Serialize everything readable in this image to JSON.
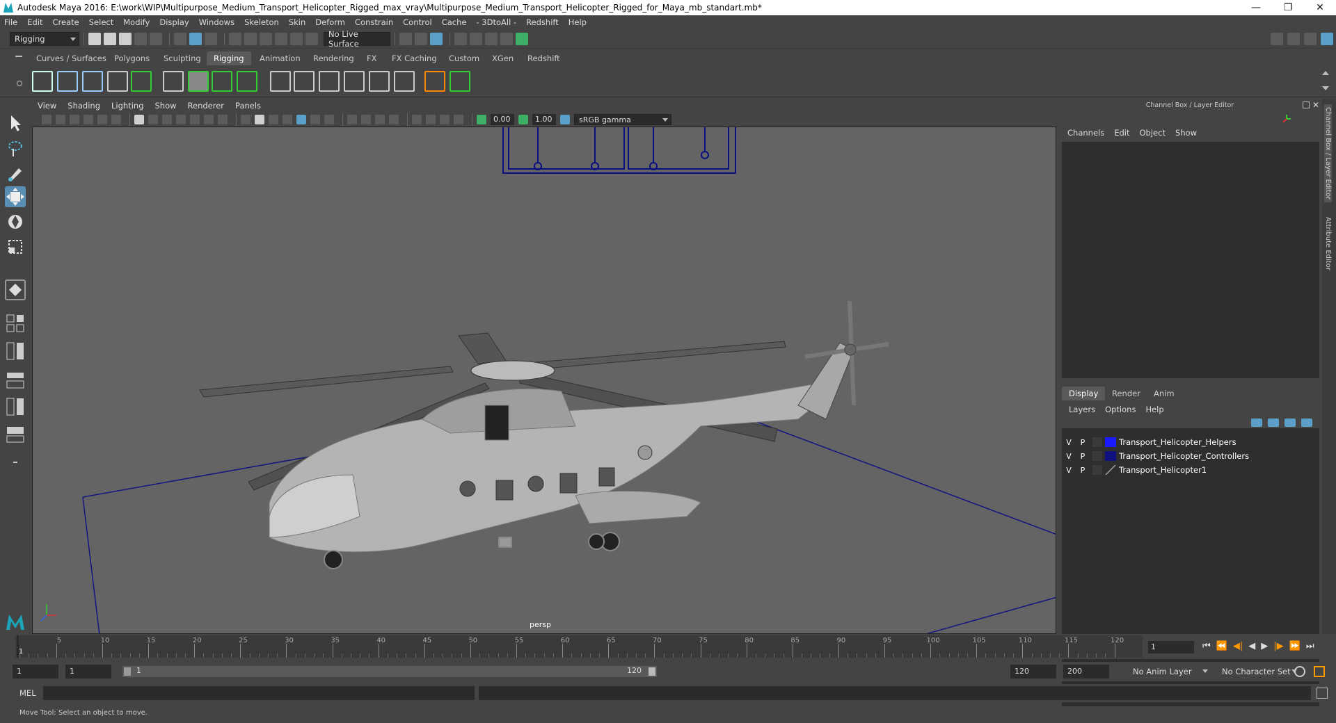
{
  "window": {
    "title": "Autodesk Maya 2016: E:\\work\\WIP\\Multipurpose_Medium_Transport_Helicopter_Rigged_max_vray\\Multipurpose_Medium_Transport_Helicopter_Rigged_for_Maya_mb_standart.mb*",
    "minimize": "—",
    "restore": "❐",
    "close": "✕"
  },
  "menubar": [
    "File",
    "Edit",
    "Create",
    "Select",
    "Modify",
    "Display",
    "Windows",
    "Skeleton",
    "Skin",
    "Deform",
    "Constrain",
    "Control",
    "Cache",
    "- 3DtoAll -",
    "Redshift",
    "Help"
  ],
  "statusline": {
    "menuset": "Rigging",
    "live_surface": "No Live Surface"
  },
  "shelf_tabs": [
    "Curves / Surfaces",
    "Polygons",
    "Sculpting",
    "Rigging",
    "Animation",
    "Rendering",
    "FX",
    "FX Caching",
    "Custom",
    "XGen",
    "Redshift"
  ],
  "shelf_active": "Rigging",
  "viewport": {
    "menu": [
      "View",
      "Shading",
      "Lighting",
      "Show",
      "Renderer",
      "Panels"
    ],
    "exposure": "0.00",
    "gamma": "1.00",
    "color_space": "sRGB gamma",
    "camera": "persp"
  },
  "channel_box": {
    "header": "Channel Box / Layer Editor",
    "menu": [
      "Channels",
      "Edit",
      "Object",
      "Show"
    ]
  },
  "layer_editor": {
    "tabs": [
      "Display",
      "Render",
      "Anim"
    ],
    "active_tab": "Display",
    "menu": [
      "Layers",
      "Options",
      "Help"
    ],
    "layers": [
      {
        "v": "V",
        "p": "P",
        "name": "Transport_Helicopter_Helpers",
        "color": "#1a1aff"
      },
      {
        "v": "V",
        "p": "P",
        "name": "Transport_Helicopter_Controllers",
        "color": "#101080"
      },
      {
        "v": "V",
        "p": "P",
        "name": "Transport_Helicopter1",
        "color": ""
      }
    ]
  },
  "side_tabs": [
    "Channel Box / Layer Editor",
    "Attribute Editor"
  ],
  "timeline": {
    "ticks": [
      "5",
      "10",
      "15",
      "20",
      "25",
      "30",
      "35",
      "40",
      "45",
      "50",
      "55",
      "60",
      "65",
      "70",
      "75",
      "80",
      "85",
      "90",
      "95",
      "100",
      "105",
      "110",
      "115",
      "120"
    ],
    "start_marker": "1",
    "current_frame": "1"
  },
  "range": {
    "start": "1",
    "playback_start": "1",
    "slider_start": "1",
    "slider_end": "120",
    "playback_end": "120",
    "end": "200",
    "anim_layer": "No Anim Layer",
    "character_set": "No Character Set"
  },
  "command_line": {
    "label": "MEL"
  },
  "help_line": "Move Tool: Select an object to move."
}
